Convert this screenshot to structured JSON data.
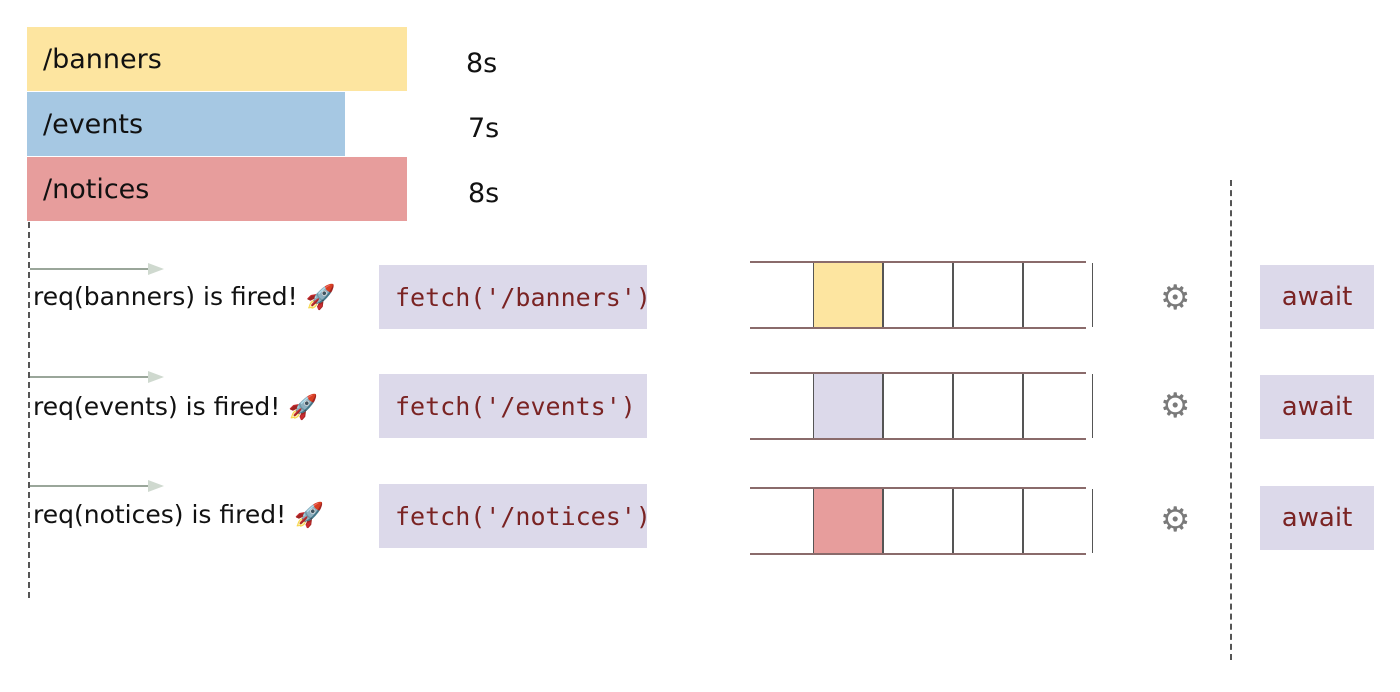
{
  "endpoints": [
    {
      "label": "/banners",
      "duration": "8s",
      "color": "#fde5a0"
    },
    {
      "label": "/events",
      "duration": "7s",
      "color": "#a6c8e3"
    },
    {
      "label": "/notices",
      "duration": "8s",
      "color": "#e79d9c"
    }
  ],
  "requests": [
    {
      "fired_text": "req(banners) is fired!",
      "call": "fetch('/banners')",
      "queue_color": "#fde5a0",
      "await": "await"
    },
    {
      "fired_text": "req(events) is fired!",
      "call": "fetch('/events')",
      "queue_color": "#dcd9ea",
      "await": "await"
    },
    {
      "fired_text": "req(notices) is fired!",
      "call": "fetch('/notices')",
      "queue_color": "#e79d9c",
      "await": "await"
    }
  ],
  "icons": {
    "rocket": "rocket-icon",
    "gear": "gear-icon"
  }
}
